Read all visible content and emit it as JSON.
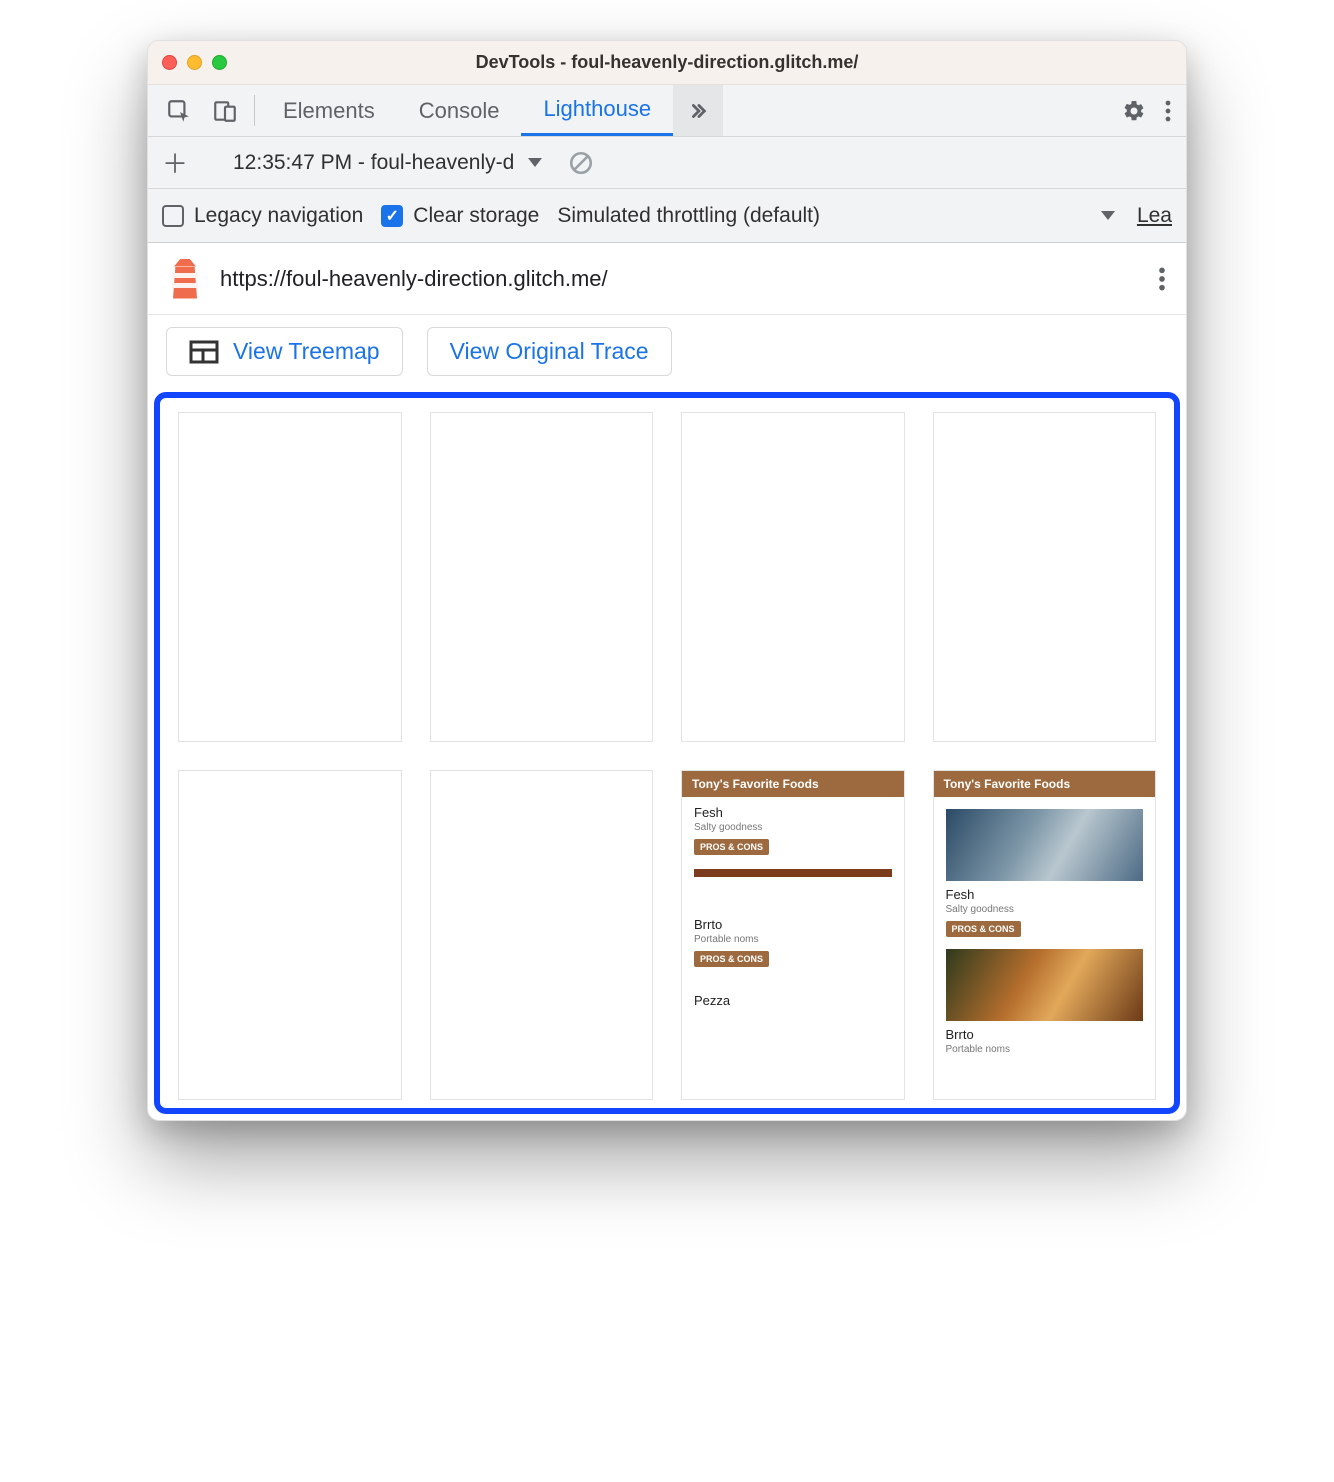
{
  "window": {
    "title": "DevTools - foul-heavenly-direction.glitch.me/"
  },
  "tabs": {
    "elements": "Elements",
    "console": "Console",
    "lighthouse": "Lighthouse"
  },
  "run": {
    "label": "12:35:47 PM - foul-heavenly-d"
  },
  "options": {
    "legacy": "Legacy navigation",
    "clear": "Clear storage",
    "throttling": "Simulated throttling (default)",
    "overflow": "Lea"
  },
  "url": "https://foul-heavenly-direction.glitch.me/",
  "actions": {
    "treemap": "View Treemap",
    "trace": "View Original Trace"
  },
  "mini": {
    "header": "Tony's Favorite Foods",
    "items": [
      {
        "title": "Fesh",
        "sub": "Salty goodness",
        "btn": "PROS & CONS"
      },
      {
        "title": "Brrto",
        "sub": "Portable noms",
        "btn": "PROS & CONS"
      },
      {
        "title": "Pezza",
        "sub": "",
        "btn": ""
      }
    ]
  }
}
